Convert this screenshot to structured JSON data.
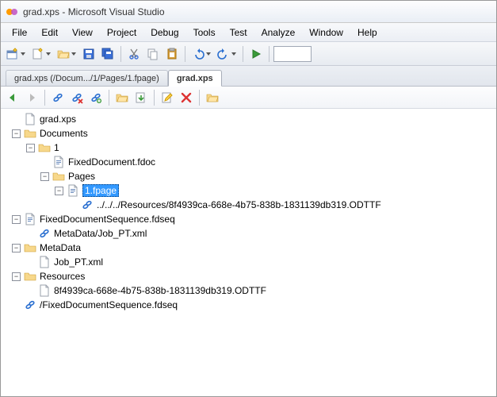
{
  "window": {
    "title": "grad.xps - Microsoft Visual Studio"
  },
  "menubar": [
    "File",
    "Edit",
    "View",
    "Project",
    "Debug",
    "Tools",
    "Test",
    "Analyze",
    "Window",
    "Help"
  ],
  "tabs": {
    "inactive": "grad.xps (/Docum.../1/Pages/1.fpage)",
    "active": "grad.xps"
  },
  "main_toolbar_icons": [
    {
      "name": "new-project-icon",
      "kind": "newproj",
      "arrow": true
    },
    {
      "name": "add-item-icon",
      "kind": "additem",
      "arrow": true
    },
    {
      "name": "open-icon",
      "kind": "open",
      "arrow": true
    },
    {
      "name": "save-icon",
      "kind": "save"
    },
    {
      "name": "save-all-icon",
      "kind": "saveall"
    },
    {
      "name": "sep"
    },
    {
      "name": "cut-icon",
      "kind": "cut"
    },
    {
      "name": "copy-icon",
      "kind": "copy"
    },
    {
      "name": "paste-icon",
      "kind": "paste"
    },
    {
      "name": "sep"
    },
    {
      "name": "undo-icon",
      "kind": "undo",
      "arrow": true
    },
    {
      "name": "redo-icon",
      "kind": "redo",
      "arrow": true
    },
    {
      "name": "sep"
    },
    {
      "name": "start-icon",
      "kind": "play"
    },
    {
      "name": "sep"
    }
  ],
  "doc_toolbar_icons": [
    {
      "name": "back-icon",
      "kind": "back"
    },
    {
      "name": "forward-icon",
      "kind": "fwd"
    },
    {
      "name": "sep"
    },
    {
      "name": "link-icon",
      "kind": "link"
    },
    {
      "name": "link-remove-icon",
      "kind": "linkx"
    },
    {
      "name": "link-add-icon",
      "kind": "linkplus"
    },
    {
      "name": "sep"
    },
    {
      "name": "folder-open-icon",
      "kind": "open"
    },
    {
      "name": "export-icon",
      "kind": "export"
    },
    {
      "name": "sep"
    },
    {
      "name": "edit-icon",
      "kind": "edit"
    },
    {
      "name": "delete-icon",
      "kind": "delete"
    },
    {
      "name": "sep"
    },
    {
      "name": "open-folder-icon",
      "kind": "open"
    }
  ],
  "tree": [
    {
      "depth": 0,
      "toggle": "",
      "icon": "file",
      "label": "grad.xps",
      "sel": false
    },
    {
      "depth": 0,
      "toggle": "-",
      "icon": "folder",
      "label": "Documents",
      "sel": false
    },
    {
      "depth": 1,
      "toggle": "-",
      "icon": "folder",
      "label": "1",
      "sel": false
    },
    {
      "depth": 2,
      "toggle": "",
      "icon": "doc",
      "label": "FixedDocument.fdoc",
      "sel": false
    },
    {
      "depth": 2,
      "toggle": "-",
      "icon": "folder",
      "label": "Pages",
      "sel": false
    },
    {
      "depth": 3,
      "toggle": "-",
      "icon": "doc",
      "label": "1.fpage",
      "sel": true
    },
    {
      "depth": 4,
      "toggle": "",
      "icon": "link",
      "label": "../../../Resources/8f4939ca-668e-4b75-838b-1831139db319.ODTTF",
      "sel": false
    },
    {
      "depth": 0,
      "toggle": "-",
      "icon": "doc",
      "label": "FixedDocumentSequence.fdseq",
      "sel": false
    },
    {
      "depth": 1,
      "toggle": "",
      "icon": "link",
      "label": "MetaData/Job_PT.xml",
      "sel": false
    },
    {
      "depth": 0,
      "toggle": "-",
      "icon": "folder",
      "label": "MetaData",
      "sel": false
    },
    {
      "depth": 1,
      "toggle": "",
      "icon": "file",
      "label": "Job_PT.xml",
      "sel": false
    },
    {
      "depth": 0,
      "toggle": "-",
      "icon": "folder",
      "label": "Resources",
      "sel": false
    },
    {
      "depth": 1,
      "toggle": "",
      "icon": "file",
      "label": "8f4939ca-668e-4b75-838b-1831139db319.ODTTF",
      "sel": false
    },
    {
      "depth": 0,
      "toggle": "",
      "icon": "link",
      "label": "/FixedDocumentSequence.fdseq",
      "sel": false
    }
  ]
}
